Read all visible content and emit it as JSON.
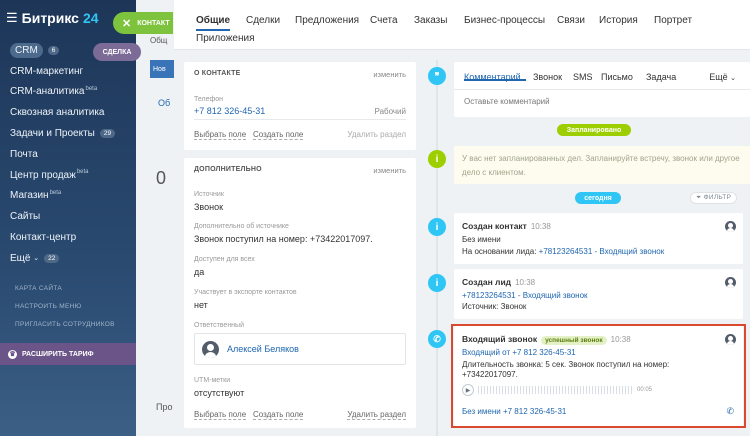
{
  "sidebar": {
    "logo_name": "Битрикс",
    "logo_version": "24",
    "items": [
      {
        "label": "CRM",
        "sup": "",
        "badge": "6"
      },
      {
        "label": "CRM-маркетинг",
        "sup": "",
        "badge": ""
      },
      {
        "label": "CRM-аналитика",
        "sup": "beta",
        "badge": ""
      },
      {
        "label": "Сквозная аналитика",
        "sup": "",
        "badge": ""
      },
      {
        "label": "Задачи и Проекты",
        "sup": "",
        "badge": "29"
      },
      {
        "label": "Почта",
        "sup": "",
        "badge": ""
      },
      {
        "label": "Центр продаж",
        "sup": "beta",
        "badge": ""
      },
      {
        "label": "Магазин",
        "sup": "beta",
        "badge": ""
      },
      {
        "label": "Сайты",
        "sup": "",
        "badge": ""
      },
      {
        "label": "Контакт-центр",
        "sup": "",
        "badge": ""
      },
      {
        "label": "Ещё",
        "sup": "",
        "badge": "22"
      }
    ],
    "section_sitemap": "КАРТА САЙТА",
    "section_setup": "НАСТРОИТЬ МЕНЮ",
    "section_invite": "ПРИГЛАСИТЬ СОТРУДНИКОВ",
    "tariff": "РАСШИРИТЬ ТАРИФ"
  },
  "close_tab": {
    "label": "КОНТАКТ"
  },
  "background": {
    "deal_pill": "СДЕЛКА",
    "general": "Общ",
    "new": "Нов",
    "tab": "Об",
    "zero": "0",
    "pro": "Про"
  },
  "tabs": [
    "Общие",
    "Сделки",
    "Предложения",
    "Счета",
    "Заказы",
    "Бизнес-процессы",
    "Связи",
    "История",
    "Портрет",
    "Приложения"
  ],
  "about_card": {
    "title": "О КОНТАКТЕ",
    "edit": "изменить",
    "phone_label": "Телефон",
    "phone_value": "+7 812 326-45-31",
    "phone_type": "Рабочий",
    "choose_field": "Выбрать поле",
    "create_field": "Создать поле",
    "delete_section": "Удалить раздел"
  },
  "extra_card": {
    "title": "ДОПОЛНИТЕЛЬНО",
    "edit": "изменить",
    "source_label": "Источник",
    "source_value": "Звонок",
    "source_more_label": "Дополнительно об источнике",
    "source_more_value": "Звонок поступил на номер: +73422017097.",
    "available_label": "Доступен для всех",
    "available_value": "да",
    "export_label": "Участвует в экспорте контактов",
    "export_value": "нет",
    "responsible_label": "Ответственный",
    "responsible_name": "Алексей Беляков",
    "utm_label": "UTM-метки",
    "utm_value": "отсутствуют",
    "choose_field": "Выбрать поле",
    "create_field": "Создать поле",
    "delete_section": "Удалить раздел"
  },
  "editor": {
    "tabs": [
      "Комментарий",
      "Звонок",
      "SMS",
      "Письмо",
      "Задача"
    ],
    "more": "Ещё",
    "placeholder": "Оставьте комментарий"
  },
  "timeline": {
    "planned_label": "Запланировано",
    "planned_note": "У вас нет запланированных дел. Запланируйте встречу, звонок или другое дело с клиентом.",
    "today_label": "сегодня",
    "filter_label": "ФИЛЬТР",
    "events": [
      {
        "title": "Создан контакт",
        "time": "10:38",
        "line1": "Без имени",
        "line2_prefix": "На основании лида: ",
        "line2_link": "+78123264531 - Входящий звонок"
      },
      {
        "title": "Создан лид",
        "time": "10:38",
        "line1": "+78123264531 - Входящий звонок",
        "line2": "Источник: Звонок"
      }
    ],
    "call": {
      "title": "Входящий звонок",
      "status": "успешный звонок",
      "time": "10:38",
      "from": "Входящий от +7 812 326-45-31",
      "duration_line1": "Длительность звонка: 5 сек. Звонок поступил на номер:",
      "duration_line2": "+73422017097.",
      "player_time": "00:05",
      "contact_name": "Без имени",
      "contact_phone": "+7 812 326-45-31"
    }
  }
}
